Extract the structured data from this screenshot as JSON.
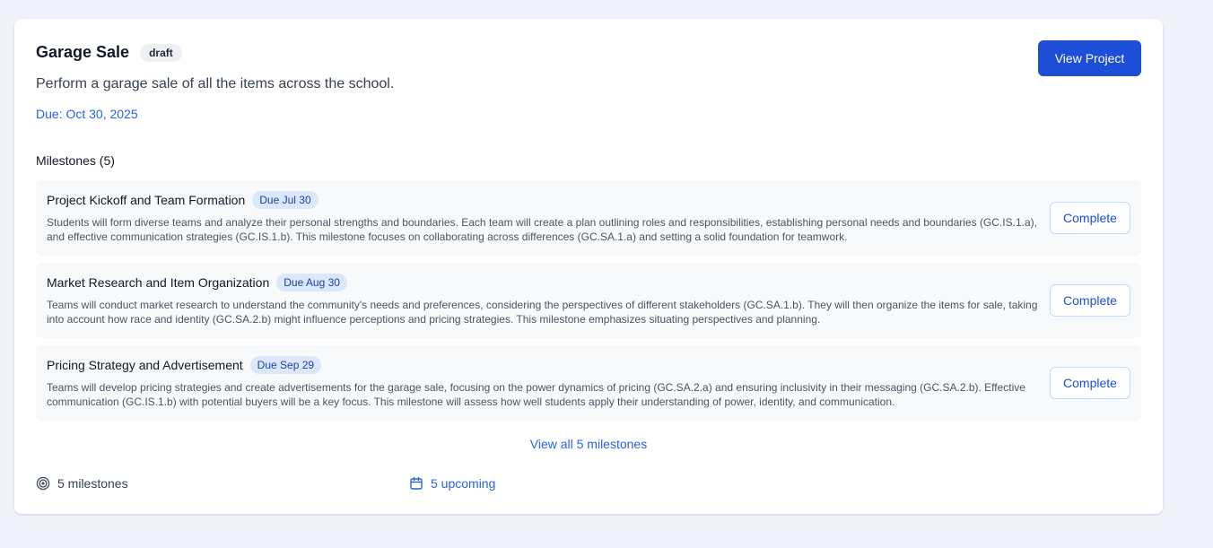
{
  "project": {
    "title": "Garage Sale",
    "status_badge": "draft",
    "description": "Perform a garage sale of all the items across the school.",
    "due": "Due: Oct 30, 2025",
    "view_button": "View Project"
  },
  "milestones_section": {
    "heading": "Milestones (5)",
    "items": [
      {
        "title": "Project Kickoff and Team Formation",
        "due": "Due Jul 30",
        "description": "Students will form diverse teams and analyze their personal strengths and boundaries. Each team will create a plan outlining roles and responsibilities, establishing personal needs and boundaries (GC.IS.1.a), and effective communication strategies (GC.IS.1.b). This milestone focuses on collaborating across differences (GC.SA.1.a) and setting a solid foundation for teamwork.",
        "action": "Complete"
      },
      {
        "title": "Market Research and Item Organization",
        "due": "Due Aug 30",
        "description": "Teams will conduct market research to understand the community's needs and preferences, considering the perspectives of different stakeholders (GC.SA.1.b). They will then organize the items for sale, taking into account how race and identity (GC.SA.2.b) might influence perceptions and pricing strategies. This milestone emphasizes situating perspectives and planning.",
        "action": "Complete"
      },
      {
        "title": "Pricing Strategy and Advertisement",
        "due": "Due Sep 29",
        "description": "Teams will develop pricing strategies and create advertisements for the garage sale, focusing on the power dynamics of pricing (GC.SA.2.a) and ensuring inclusivity in their messaging (GC.SA.2.b). Effective communication (GC.IS.1.b) with potential buyers will be a key focus. This milestone will assess how well students apply their understanding of power, identity, and communication.",
        "action": "Complete"
      }
    ],
    "view_all": "View all 5 milestones"
  },
  "footer": {
    "milestones_count": "5 milestones",
    "milestones_icon": "target-icon",
    "upcoming": "5 upcoming",
    "upcoming_icon": "calendar-icon"
  },
  "colors": {
    "accent": "#1d4ed8",
    "link": "#2563eb",
    "page_bg": "#f1f3fc",
    "milestone_bg": "#f8f9fb",
    "due_badge_bg": "#dbe7fb"
  }
}
